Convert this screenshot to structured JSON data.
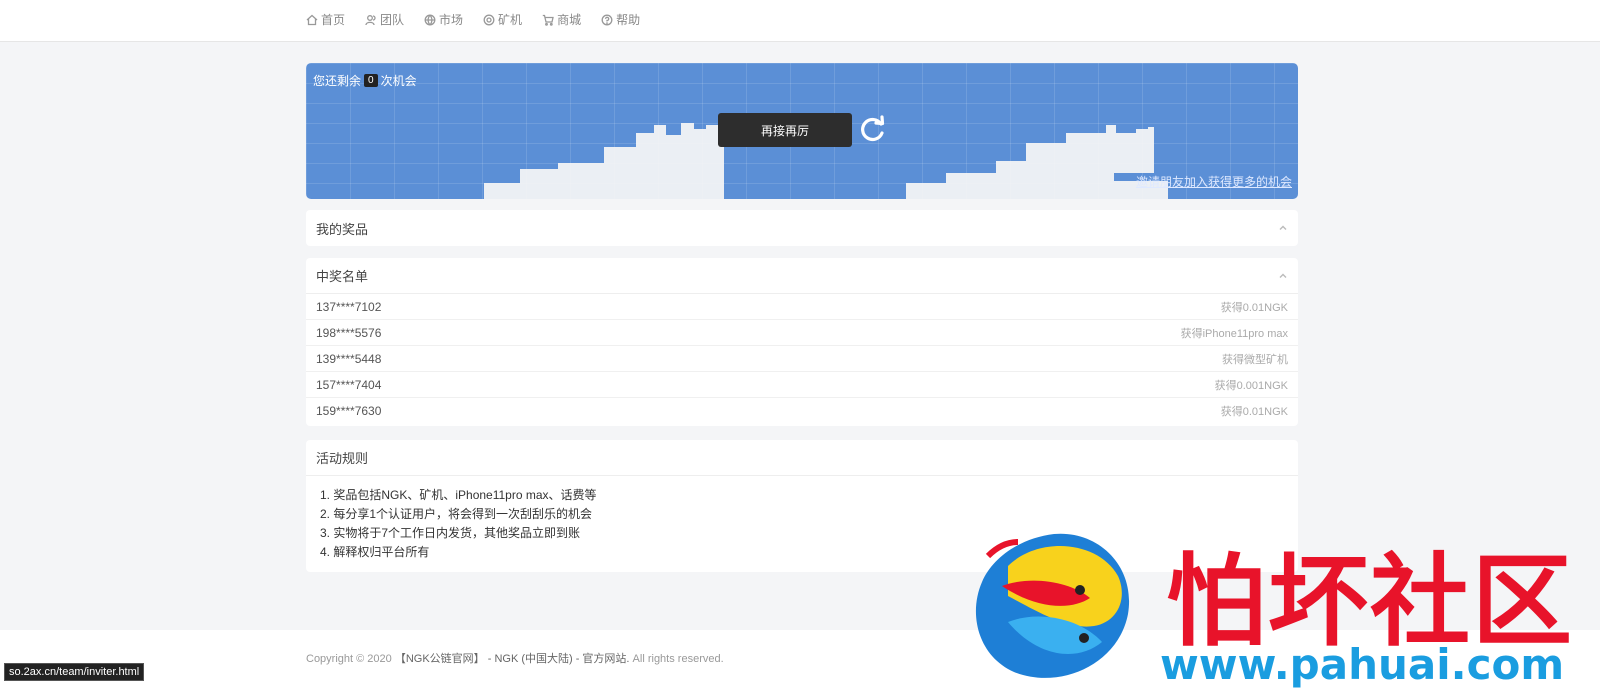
{
  "nav": {
    "items": [
      {
        "label": "首页",
        "icon": "home-icon"
      },
      {
        "label": "团队",
        "icon": "team-icon"
      },
      {
        "label": "市场",
        "icon": "globe-icon"
      },
      {
        "label": "矿机",
        "icon": "miner-icon"
      },
      {
        "label": "商城",
        "icon": "cart-icon"
      },
      {
        "label": "帮助",
        "icon": "help-icon"
      }
    ]
  },
  "hero": {
    "chance_prefix": "您还剩余",
    "chance_count": "0",
    "chance_suffix": "次机会",
    "retry_label": "再接再厉",
    "invite_link": "邀请朋友加入获得更多的机会",
    "colors": {
      "background": "#5b8fd6",
      "button": "#2d2d2d"
    }
  },
  "my_prizes": {
    "title": "我的奖品"
  },
  "winners": {
    "title": "中奖名单",
    "rows": [
      {
        "phone": "137****7102",
        "prize": "获得0.01NGK"
      },
      {
        "phone": "198****5576",
        "prize": "获得iPhone11pro max"
      },
      {
        "phone": "139****5448",
        "prize": "获得微型矿机"
      },
      {
        "phone": "157****7404",
        "prize": "获得0.001NGK"
      },
      {
        "phone": "159****7630",
        "prize": "获得0.01NGK"
      }
    ]
  },
  "rules": {
    "title": "活动规则",
    "items": [
      "1. 奖品包括NGK、矿机、iPhone11pro max、话费等",
      "2. 每分享1个认证用户，将会得到一次刮刮乐的机会",
      "3. 实物将于7个工作日内发货，其他奖品立即到账",
      "4. 解释权归平台所有"
    ]
  },
  "footer": {
    "copyright_prefix": "Copyright © 2020 ",
    "copyright_site": "【NGK公链官网】 - NGK (中国大陆) - 官方网站.",
    "copyright_suffix": " All rights reserved."
  },
  "status_url": "so.2ax.cn/team/inviter.html",
  "watermark": {
    "title": "怕坏社区",
    "url": "www.pahuai.com",
    "colors": {
      "title": "#e8132a",
      "url": "#1a9de0"
    }
  }
}
